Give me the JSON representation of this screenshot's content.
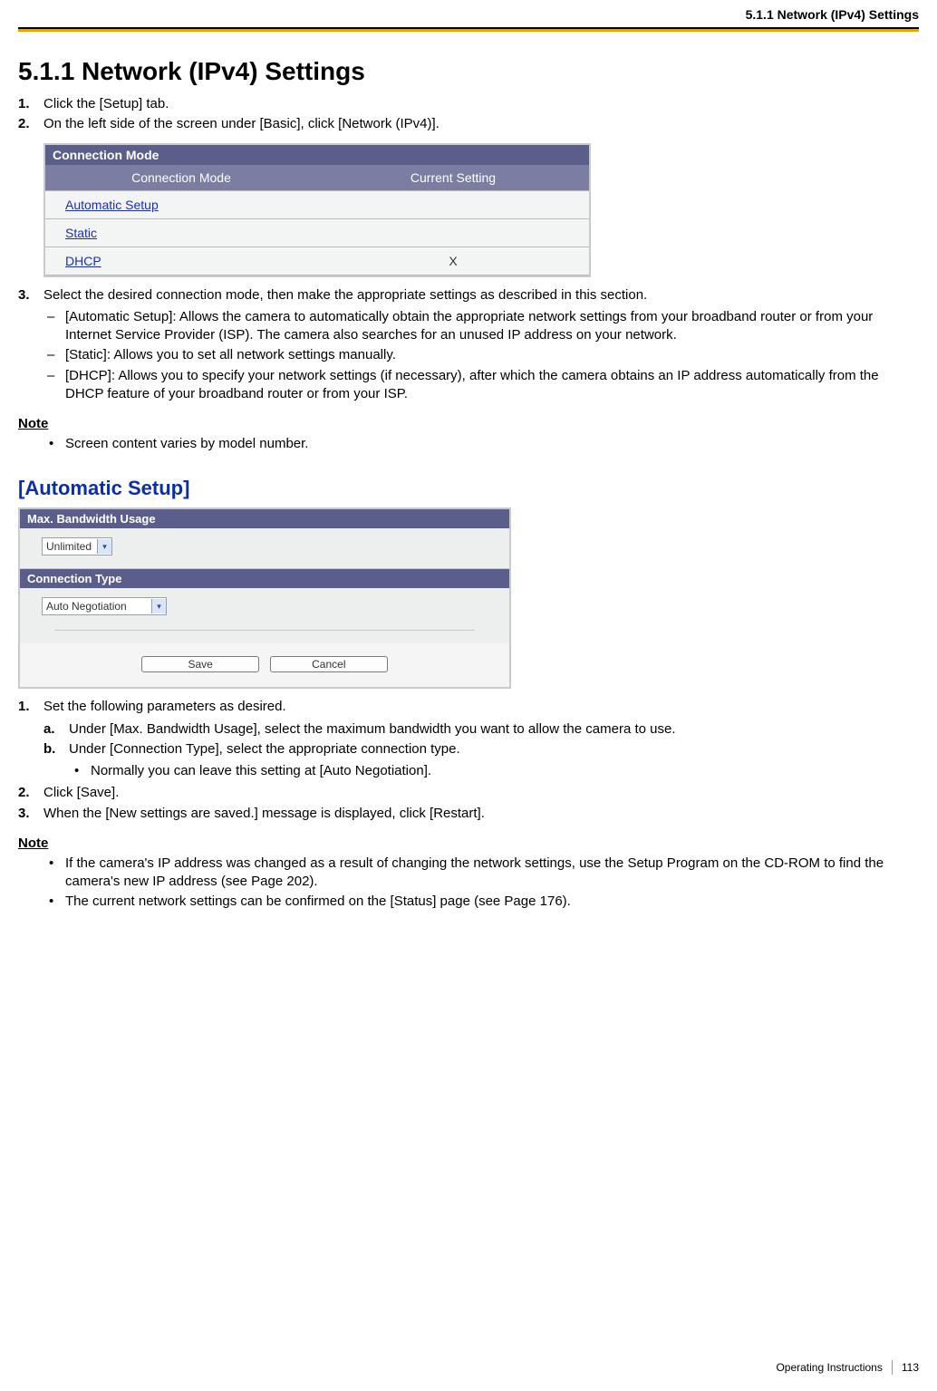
{
  "running_head": "5.1.1 Network (IPv4) Settings",
  "title": "5.1.1  Network (IPv4) Settings",
  "steps_a": [
    "Click the [Setup] tab.",
    "On the left side of the screen under [Basic], click [Network (IPv4)]."
  ],
  "figure1": {
    "title": "Connection Mode",
    "col1": "Connection Mode",
    "col2": "Current Setting",
    "rows": [
      {
        "mode": "Automatic Setup",
        "current": ""
      },
      {
        "mode": "Static",
        "current": ""
      },
      {
        "mode": "DHCP",
        "current": "X"
      }
    ]
  },
  "step3_intro": "Select the desired connection mode, then make the appropriate settings as described in this section.",
  "step3_items": [
    "[Automatic Setup]: Allows the camera to automatically obtain the appropriate network settings from your broadband router or from your Internet Service Provider (ISP). The camera also searches for an unused IP address on your network.",
    "[Static]: Allows you to set all network settings manually.",
    "[DHCP]: Allows you to specify your network settings (if necessary), after which the camera obtains an IP address automatically from the DHCP feature of your broadband router or from your ISP."
  ],
  "note_label": "Note",
  "note_a": [
    "Screen content varies by model number."
  ],
  "subhead": "[Automatic Setup]",
  "figure2": {
    "bar1": "Max. Bandwidth Usage",
    "select1": "Unlimited",
    "bar2": "Connection Type",
    "select2": "Auto Negotiation",
    "save": "Save",
    "cancel": "Cancel"
  },
  "steps_b_1": "Set the following parameters as desired.",
  "steps_b_1_sub": [
    "Under [Max. Bandwidth Usage], select the maximum bandwidth you want to allow the camera to use.",
    "Under [Connection Type], select the appropriate connection type."
  ],
  "steps_b_1_sub_bullet": [
    "Normally you can leave this setting at [Auto Negotiation]."
  ],
  "steps_b_2": "Click [Save].",
  "steps_b_3": "When the [New settings are saved.] message is displayed, click [Restart].",
  "note_b": [
    "If the camera's IP address was changed as a result of changing the network settings, use the Setup Program on the CD-ROM to find the camera's new IP address (see Page 202).",
    "The current network settings can be confirmed on the [Status] page (see Page 176)."
  ],
  "footer_label": "Operating Instructions",
  "footer_page": "113"
}
